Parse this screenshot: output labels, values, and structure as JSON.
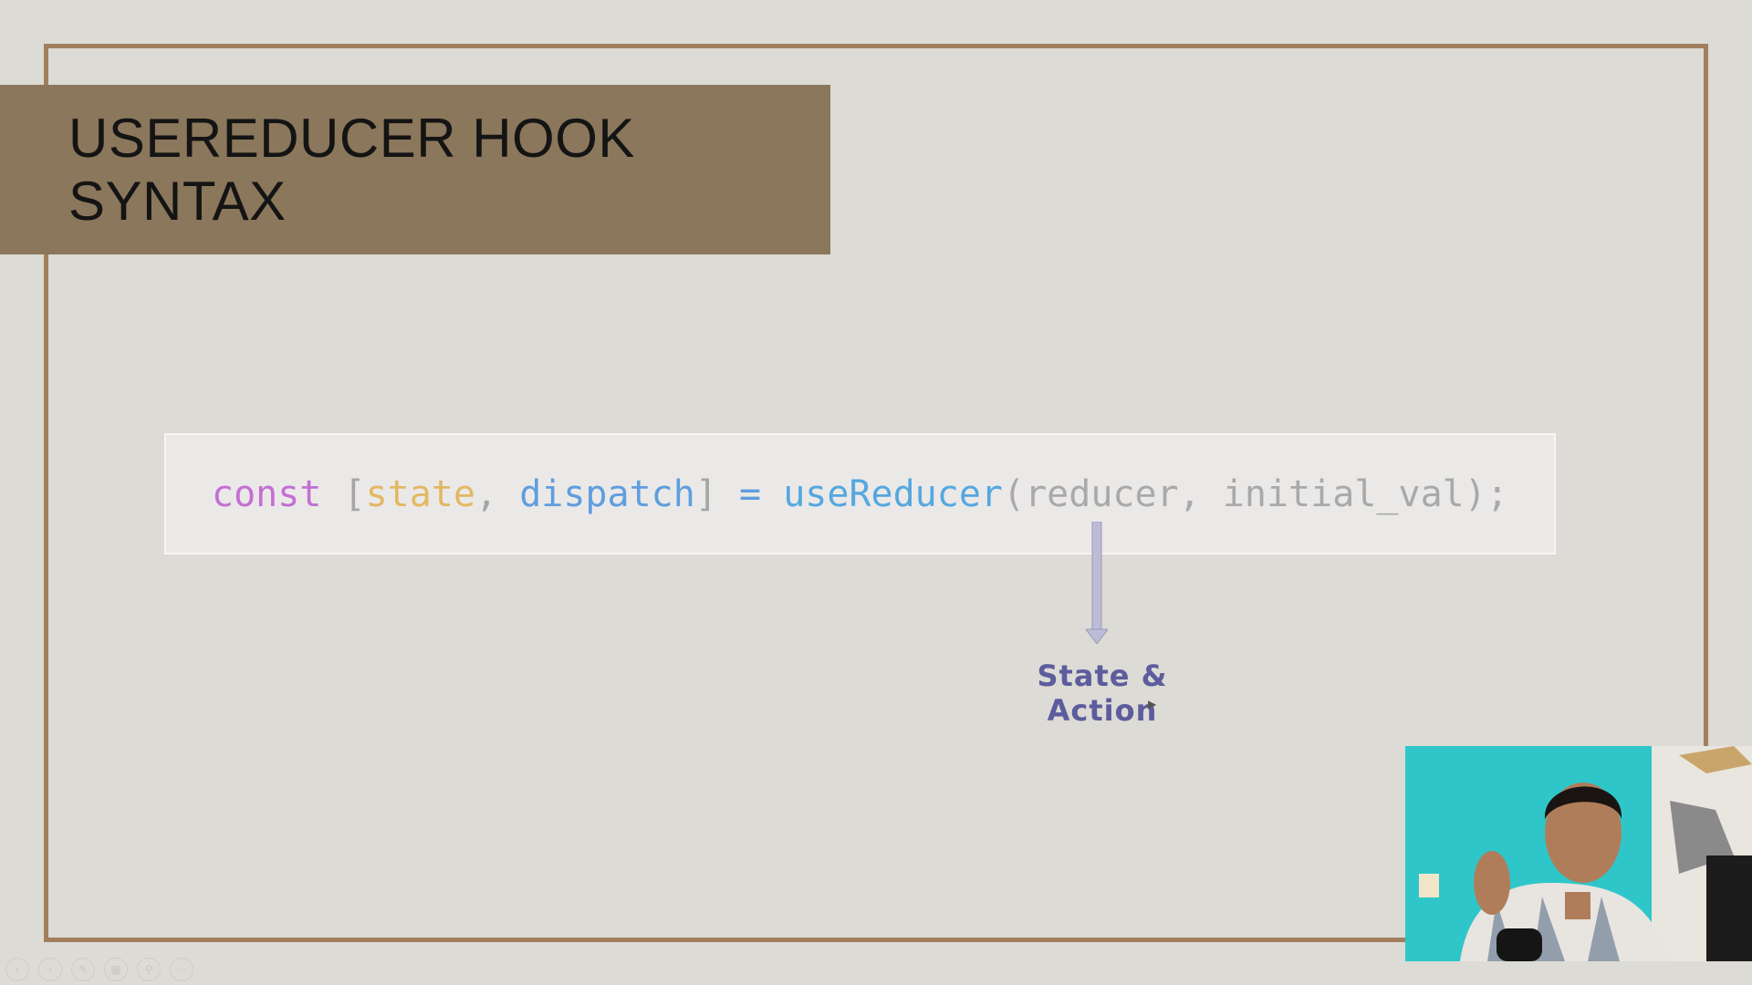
{
  "slide": {
    "title": "USEREDUCER HOOK SYNTAX",
    "code": {
      "kw": "const",
      "bracket_open": " [",
      "state": "state",
      "comma": ", ",
      "dispatch": "dispatch",
      "bracket_close": "]",
      "equals": " = ",
      "fn": "useReducer",
      "args": "(reducer, initial_val);"
    },
    "annotation": "State & Action"
  },
  "controls": [
    "prev-icon",
    "next-icon",
    "pen-icon",
    "view-icon",
    "zoom-icon",
    "more-icon"
  ],
  "colors": {
    "background": "#dcdbd5",
    "frame": "#a27f5c",
    "title_band": "#8b775b",
    "keyword": "#c46fd4",
    "state": "#e3b863",
    "dispatch": "#5f9ede",
    "function": "#55a8de",
    "annotation": "#5c5c9e",
    "webcam_bg": "#2fc6c9"
  }
}
